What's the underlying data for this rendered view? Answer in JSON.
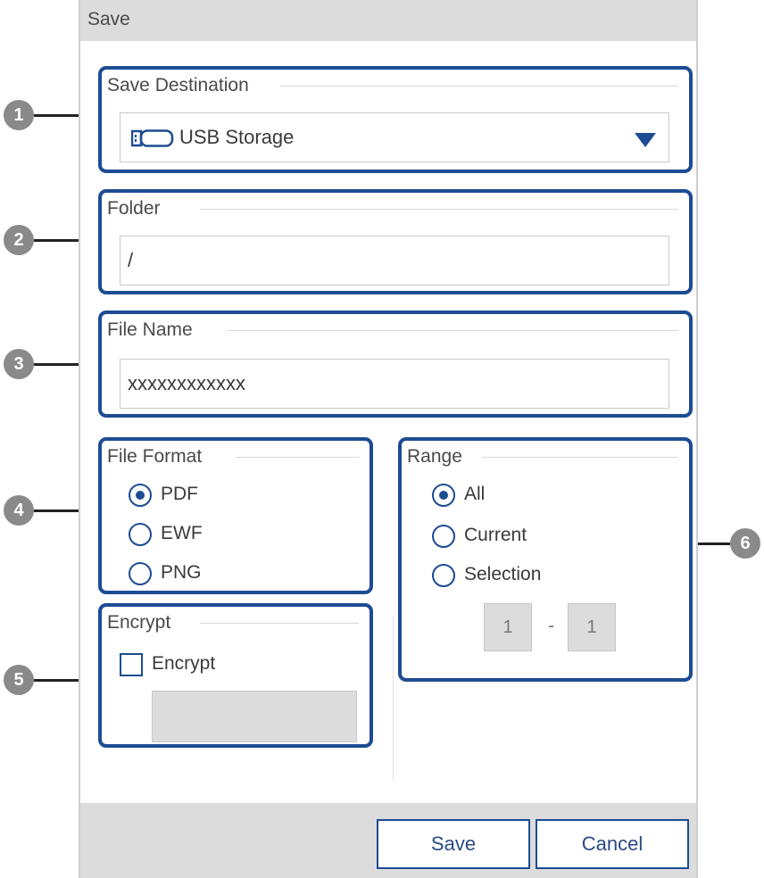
{
  "dialog": {
    "title": "Save"
  },
  "callouts": [
    "1",
    "2",
    "3",
    "4",
    "5",
    "6"
  ],
  "save_destination": {
    "legend": "Save Destination",
    "value": "USB Storage",
    "icon": "usb-storage-icon",
    "dropdown_icon": "triangle-down-icon"
  },
  "folder": {
    "legend": "Folder",
    "value": "/"
  },
  "file_name": {
    "legend": "File Name",
    "value": "xxxxxxxxxxxx"
  },
  "file_format": {
    "legend": "File Format",
    "options": [
      {
        "label": "PDF",
        "selected": true
      },
      {
        "label": "EWF",
        "selected": false
      },
      {
        "label": "PNG",
        "selected": false
      }
    ]
  },
  "encrypt": {
    "legend": "Encrypt",
    "checkbox_label": "Encrypt",
    "checked": false,
    "password_value": ""
  },
  "range": {
    "legend": "Range",
    "options": [
      {
        "label": "All",
        "selected": true
      },
      {
        "label": "Current",
        "selected": false
      },
      {
        "label": "Selection",
        "selected": false
      }
    ],
    "from": "1",
    "separator": "-",
    "to": "1"
  },
  "buttons": {
    "save": "Save",
    "cancel": "Cancel"
  },
  "colors": {
    "accent": "#1d4c93",
    "panel": "#dcdcdc",
    "callout": "#8a8a8a"
  }
}
